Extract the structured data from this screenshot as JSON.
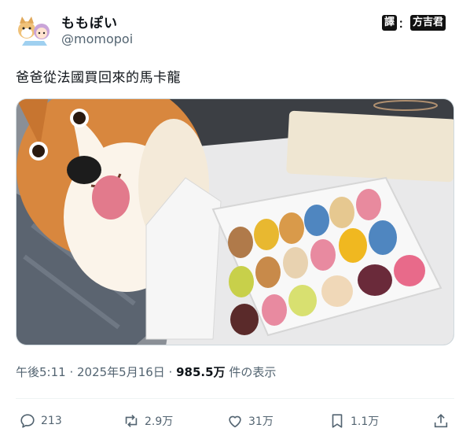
{
  "author": {
    "display_name": "ももぽい",
    "handle": "@momopoi",
    "avatar_icon": "corgi-and-girl-avatar"
  },
  "translator_badge": {
    "left": "譯",
    "separator": "：",
    "right": "方吉君"
  },
  "tweet": {
    "text": "爸爸從法國買回來的馬卡龍"
  },
  "meta": {
    "timestamp": "午後5:11 · 2025年5月16日 · ",
    "views": "985.5万",
    "views_suffix": " 件の表示"
  },
  "actions": {
    "reply": {
      "icon": "reply-icon",
      "count": "213"
    },
    "repost": {
      "icon": "repost-icon",
      "count": "2.9万"
    },
    "like": {
      "icon": "heart-icon",
      "count": "31万"
    },
    "bookmark": {
      "icon": "bookmark-icon",
      "count": "1.1万"
    },
    "share": {
      "icon": "share-icon"
    }
  },
  "colors": {
    "text_primary": "#0f1419",
    "text_secondary": "#536471",
    "border": "#cfd9de"
  }
}
